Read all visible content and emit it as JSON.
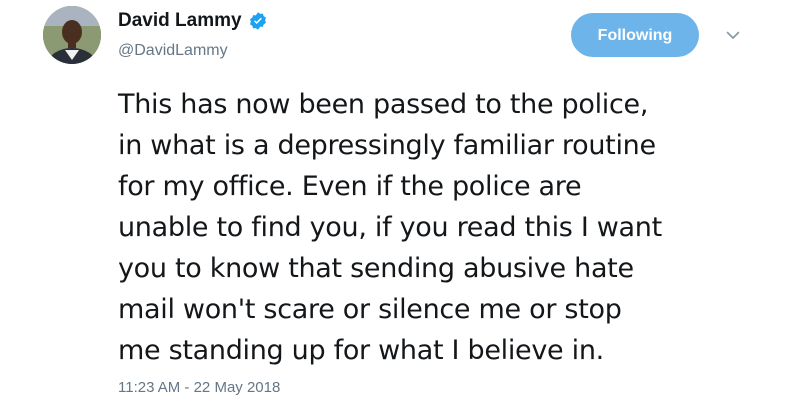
{
  "author": {
    "display_name": "David Lammy",
    "handle": "@DavidLammy",
    "verified": true,
    "avatar_icon": "profile-photo"
  },
  "follow_button": {
    "label": "Following",
    "color": "#6cb4ea"
  },
  "menu": {
    "icon": "chevron-down-icon"
  },
  "tweet": {
    "lines": [
      "This has now been passed to the police,",
      "in what is a depressingly familiar routine",
      "for my office. Even if the police are",
      "unable to find you, if you read this I want",
      "you to know that sending abusive hate",
      "mail won't scare or silence me or stop",
      "me standing up for what I believe in."
    ],
    "timestamp": "11:23 AM - 22 May 2018"
  },
  "colors": {
    "text": "#14171a",
    "secondary_text": "#657786",
    "verified_badge": "#1da1f2"
  }
}
